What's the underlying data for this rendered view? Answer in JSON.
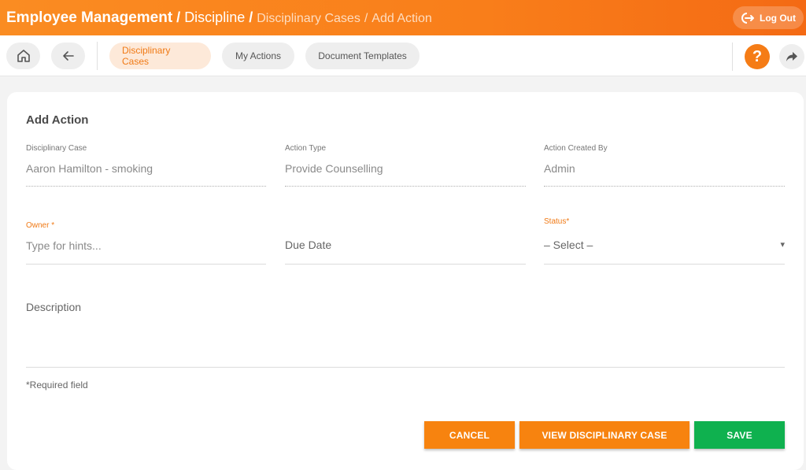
{
  "header": {
    "crumb1": "Employee Management",
    "sep1": "/",
    "crumb2": "Discipline",
    "sep2": "/",
    "crumb3": "Disciplinary Cases",
    "sep3": "/",
    "crumb4": "Add Action",
    "logout_label": "Log Out"
  },
  "toolbar": {
    "tabs": [
      {
        "label": "Disciplinary Cases",
        "active": true
      },
      {
        "label": "My Actions",
        "active": false
      },
      {
        "label": "Document Templates",
        "active": false
      }
    ],
    "help_label": "?"
  },
  "form": {
    "title": "Add Action",
    "disciplinary_case": {
      "label": "Disciplinary Case",
      "value": "Aaron Hamilton - smoking"
    },
    "action_type": {
      "label": "Action Type",
      "value": "Provide Counselling"
    },
    "created_by": {
      "label": "Action Created By",
      "value": "Admin"
    },
    "owner": {
      "label": "Owner *",
      "placeholder": "Type for hints..."
    },
    "due_date": {
      "placeholder": "Due Date"
    },
    "status": {
      "label": "Status*",
      "selected": "– Select –",
      "caret": "▾"
    },
    "description": {
      "placeholder": "Description"
    },
    "required_note": "*Required field"
  },
  "buttons": {
    "cancel": "CANCEL",
    "view_case": "VIEW DISCIPLINARY CASE",
    "save": "SAVE"
  },
  "colors": {
    "accent": "#f7830f",
    "save": "#0fb14f"
  }
}
